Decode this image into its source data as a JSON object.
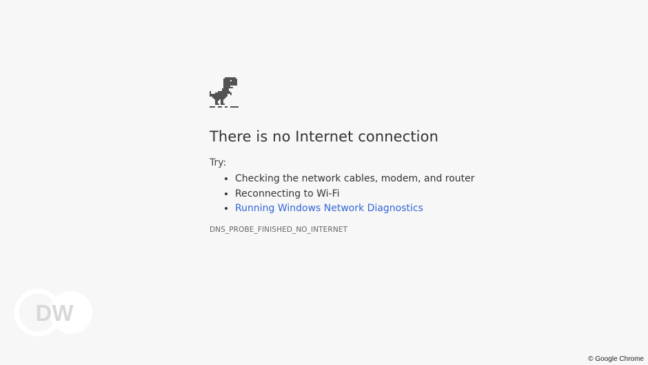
{
  "page": {
    "title": "There is no Internet connection",
    "try_label": "Try:",
    "suggestions": [
      "Checking the network cables, modem, and router",
      "Reconnecting to Wi-Fi",
      "Running Windows Network Diagnostics"
    ],
    "error_code": "DNS_PROBE_FINISHED_NO_INTERNET"
  },
  "icons": {
    "dino": "offline-dinosaur-icon"
  },
  "overlay": {
    "logo_text": "DW",
    "credit": "© Google Chrome"
  },
  "colors": {
    "background": "#f7f7f7",
    "link": "#3367d6",
    "text": "#333333"
  }
}
